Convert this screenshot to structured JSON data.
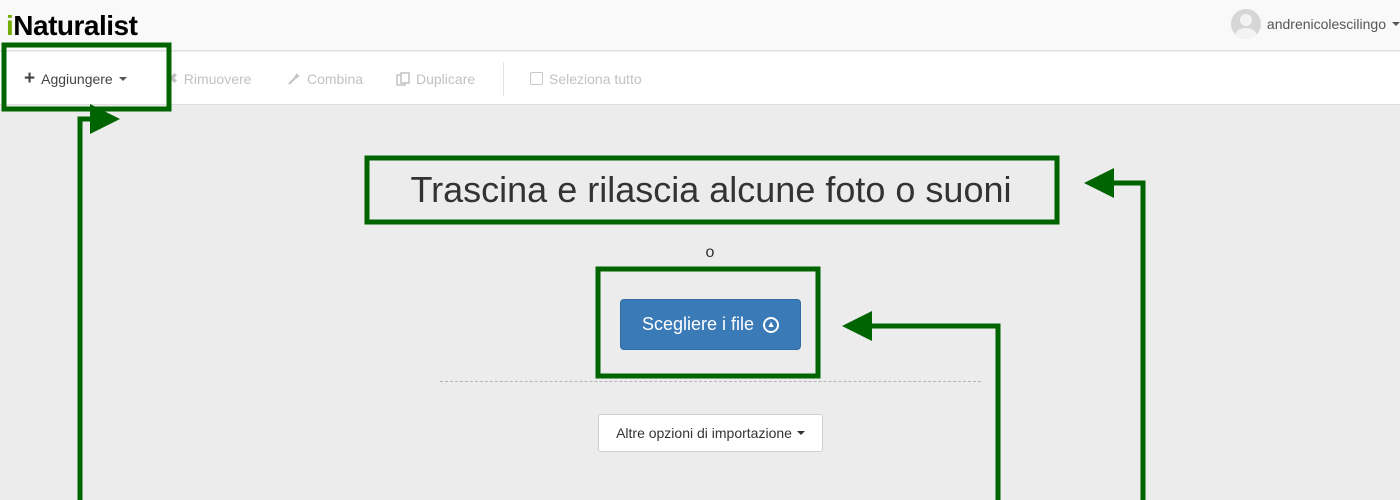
{
  "header": {
    "logo_lead": "i",
    "logo_rest": "Naturalist",
    "username": "andrenicolescilingo"
  },
  "toolbar": {
    "add_label": "Aggiungere",
    "remove_label": "Rimuovere",
    "combine_label": "Combina",
    "duplicate_label": "Duplicare",
    "select_all_label": "Seleziona tutto"
  },
  "main": {
    "drop_title": "Trascina e rilascia alcune foto o suoni",
    "or_text": "o",
    "choose_files_label": "Scegliere i file",
    "more_import_label": "Altre opzioni di importazione"
  },
  "colors": {
    "annotation_green": "#006400",
    "primary_button": "#3a7ab7",
    "logo_green": "#74ac00"
  },
  "icons": {
    "add": "plus-icon",
    "remove": "x-icon",
    "combine": "wand-icon",
    "duplicate": "copy-icon",
    "select_all": "checkbox-icon",
    "upload": "upload-circle-icon"
  }
}
